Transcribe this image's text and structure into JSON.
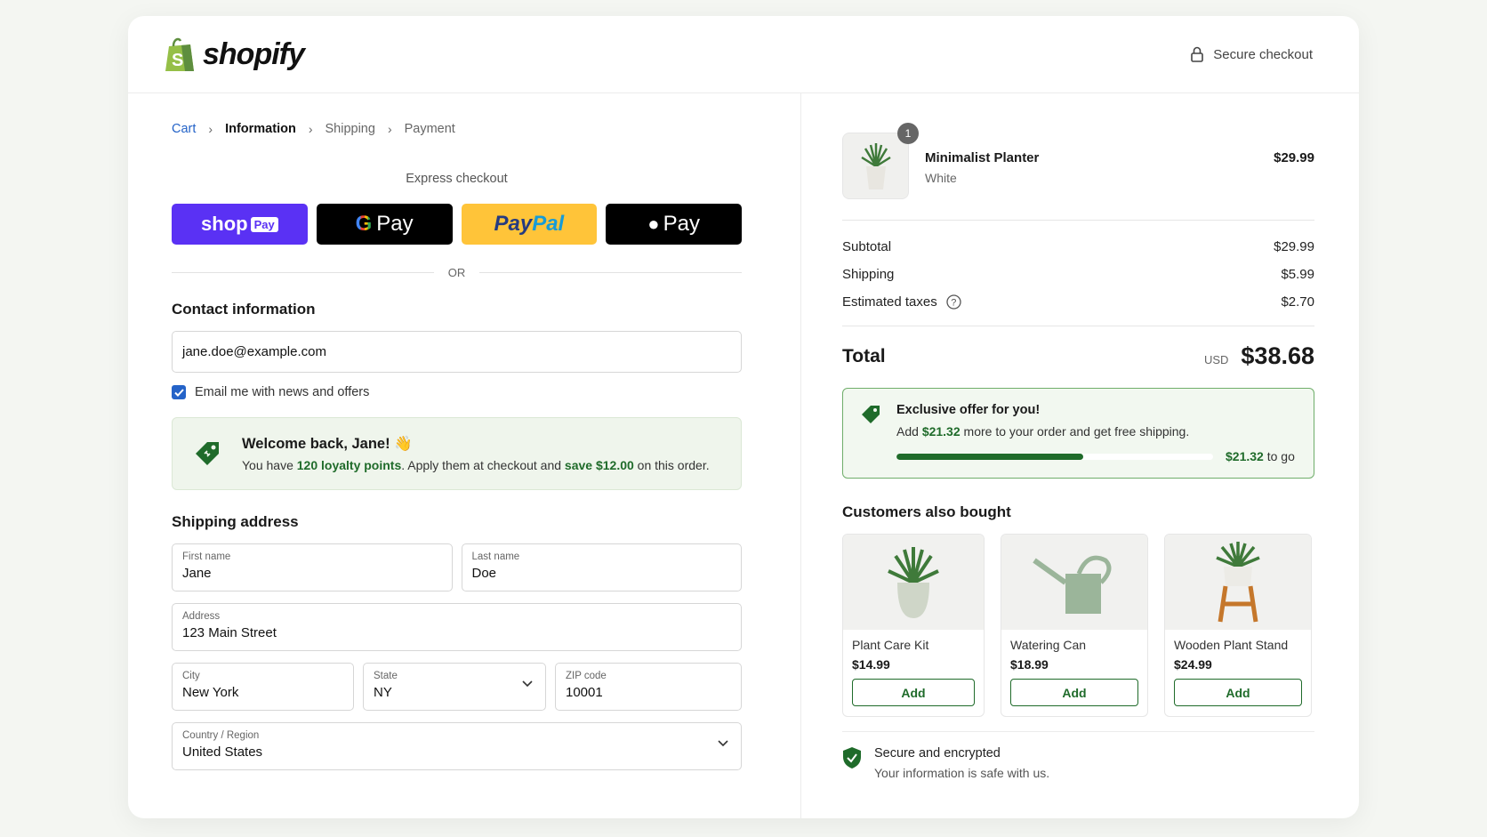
{
  "header": {
    "logo_text": "shopify",
    "secure_label": "Secure checkout"
  },
  "breadcrumb": {
    "cart": "Cart",
    "information": "Information",
    "shipping": "Shipping",
    "payment": "Payment"
  },
  "express": {
    "label": "Express checkout",
    "shop_pay": "shop",
    "shop_pay_badge": "Pay",
    "gpay": "Pay",
    "paypal_a": "Pay",
    "paypal_b": "Pal",
    "apple_pay": "Pay",
    "or": "OR"
  },
  "contact": {
    "title": "Contact information",
    "email": "jane.doe@example.com",
    "newsletter_label": "Email me with news and offers",
    "newsletter_checked": true
  },
  "welcome": {
    "title": "Welcome back, Jane! 👋",
    "text_a": "You have ",
    "points": "120 loyalty points",
    "text_b": ". Apply them at checkout and ",
    "save": "save $12.00",
    "text_c": " on this order."
  },
  "shipping": {
    "title": "Shipping address",
    "first_name_label": "First name",
    "first_name": "Jane",
    "last_name_label": "Last name",
    "last_name": "Doe",
    "address_label": "Address",
    "address": "123 Main Street",
    "city_label": "City",
    "city": "New York",
    "state_label": "State",
    "state": "NY",
    "zip_label": "ZIP code",
    "zip": "10001",
    "country_label": "Country / Region",
    "country": "United States"
  },
  "order": {
    "item": {
      "name": "Minimalist Planter",
      "variant": "White",
      "price": "$29.99",
      "qty": "1"
    },
    "subtotal_label": "Subtotal",
    "subtotal": "$29.99",
    "shipping_label": "Shipping",
    "shipping": "$5.99",
    "taxes_label": "Estimated taxes",
    "taxes": "$2.70",
    "total_label": "Total",
    "currency": "USD",
    "total": "$38.68"
  },
  "offer": {
    "title": "Exclusive offer for you!",
    "text_a": "Add ",
    "amount": "$21.32",
    "text_b": " more to your order and get free shipping.",
    "togo_amount": "$21.32",
    "togo_text": " to go",
    "progress": 0.59
  },
  "also_bought": {
    "title": "Customers also bought",
    "products": [
      {
        "name": "Plant Care Kit",
        "price": "$14.99",
        "add": "Add"
      },
      {
        "name": "Watering Can",
        "price": "$18.99",
        "add": "Add"
      },
      {
        "name": "Wooden Plant Stand",
        "price": "$24.99",
        "add": "Add"
      }
    ]
  },
  "secure_footer": {
    "title": "Secure and encrypted",
    "subtitle": "Your information is safe with us."
  },
  "colors": {
    "accent_green": "#1f6b2a",
    "link_blue": "#2463c8",
    "shop_pay": "#5a31f4",
    "paypal": "#ffc439"
  }
}
